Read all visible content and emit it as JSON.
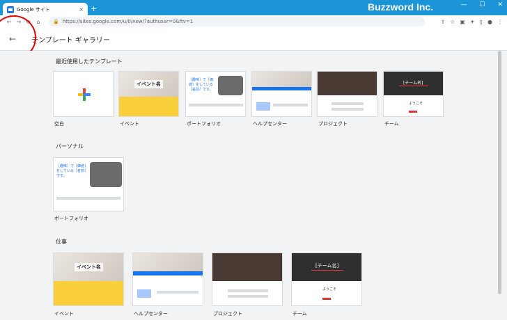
{
  "browser": {
    "tab_title": "Google サイト",
    "tab_close": "×",
    "new_tab": "+",
    "url": "https://sites.google.com/u/0/new/?authuser=0&ftv=1",
    "brand": "Buzzword Inc.",
    "win_min": "—",
    "win_max": "☐",
    "win_close": "✕"
  },
  "app": {
    "back_glyph": "←",
    "title": "テンプレート ギャラリー"
  },
  "sections": {
    "recent": {
      "title": "最近使用したテンプレート",
      "items": [
        {
          "label": "空白"
        },
        {
          "label": "イベント"
        },
        {
          "label": "ポートフォリオ"
        },
        {
          "label": "ヘルプセンター"
        },
        {
          "label": "プロジェクト"
        },
        {
          "label": "チーム"
        }
      ]
    },
    "personal": {
      "title": "パーソナル",
      "items": [
        {
          "label": "ポートフォリオ"
        }
      ]
    },
    "work": {
      "title": "仕事",
      "items": [
        {
          "label": "イベント"
        },
        {
          "label": "ヘルプセンター"
        },
        {
          "label": "プロジェクト"
        },
        {
          "label": "チーム"
        }
      ]
    }
  },
  "thumb_text": {
    "event_name": "イベント名",
    "team_name": "[チーム名]",
    "portfolio_tagline": "［趣味］で［価値］をしている［名前］です。",
    "welcome": "ようこそ"
  },
  "colors": {
    "chrome_blue": "#1b95d7",
    "gallery_bg": "#f1f3f4",
    "google_blue": "#4285f4",
    "google_red": "#ea4335",
    "google_yellow": "#fbbc04",
    "google_green": "#34a853"
  }
}
